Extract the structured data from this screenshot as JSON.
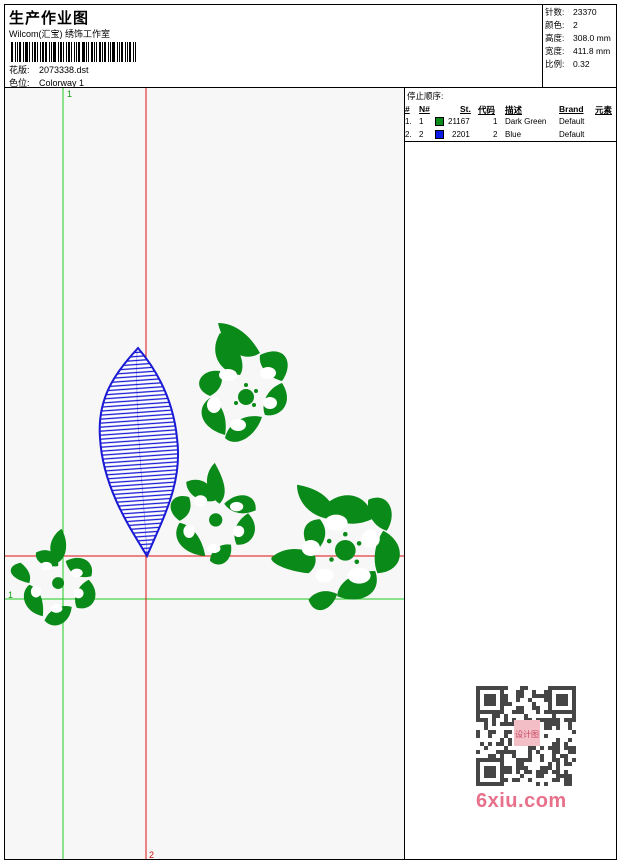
{
  "header": {
    "title": "生产作业图",
    "subtitle": "Wilcom(汇宝) 绣饰工作室",
    "design_label": "花版:",
    "design_value": "2073338.dst",
    "colorway_label": "色位:",
    "colorway_value": "Colorway 1"
  },
  "stats": [
    {
      "label": "针数:",
      "value": "23370"
    },
    {
      "label": "颜色:",
      "value": "2"
    },
    {
      "label": "高度:",
      "value": "308.0 mm"
    },
    {
      "label": "宽度:",
      "value": "411.8 mm"
    },
    {
      "label": "比例:",
      "value": "0.32"
    }
  ],
  "legend": {
    "title": "停止顺序:",
    "headers": {
      "num": "#",
      "n": "N#",
      "st": "St.",
      "code": "代码",
      "desc": "描述",
      "brand": "Brand",
      "element": "元素"
    },
    "rows": [
      {
        "num": "1.",
        "n": "1",
        "color": "#0a8a18",
        "st": "21167",
        "code": "1",
        "desc": "Dark Green",
        "brand": "Default"
      },
      {
        "num": "2.",
        "n": "2",
        "color": "#0a1ae6",
        "st": "2201",
        "code": "2",
        "desc": "Blue",
        "brand": "Default"
      }
    ]
  },
  "canvas": {
    "markers": {
      "v1": "1",
      "h1": "1",
      "h2": "2",
      "v2": "2"
    },
    "colors": {
      "green_axis": "#22cc22",
      "red_axis": "#dd1111",
      "thread_green": "#0a8a18",
      "thread_blue": "#1a1ad6"
    }
  },
  "watermark": {
    "text": "6xiu.com",
    "stamp": "设计图"
  }
}
